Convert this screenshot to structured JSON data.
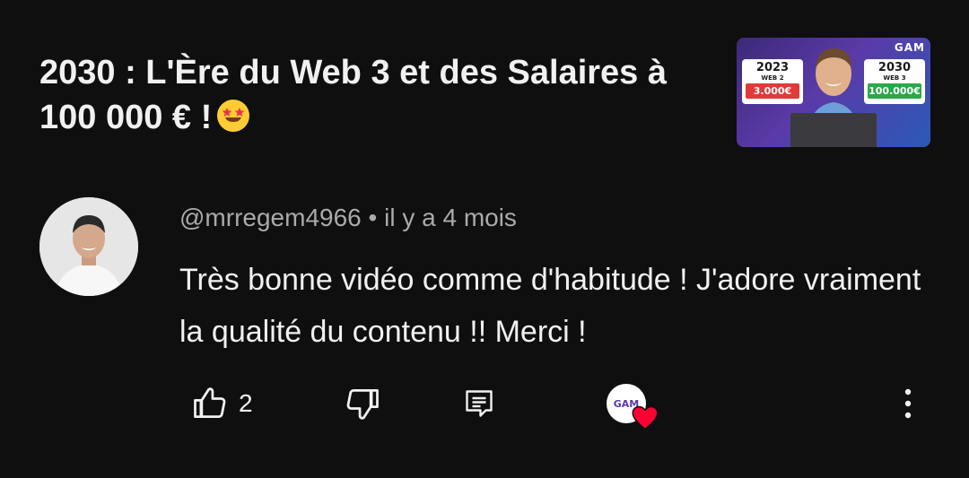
{
  "video": {
    "title": "2030 : L'Ère du Web 3 et des Salaires à 100 000 € !",
    "title_emoji": "star-struck-emoji",
    "thumbnail": {
      "logo": "GAM",
      "left_card": {
        "year": "2023",
        "web": "WEB 2",
        "amount": "3.000€"
      },
      "right_card": {
        "year": "2030",
        "web": "WEB 3",
        "amount": "100.000€"
      }
    }
  },
  "comment": {
    "author": "@mrregem4966",
    "separator": " • ",
    "time": "il y a 4 mois",
    "text": "Très bonne vidéo comme d'habitude ! J'adore vraiment la qualité du contenu !! Merci !",
    "like_count": "2",
    "creator_logo": "GAM"
  },
  "icons": {
    "like": "thumb-up-icon",
    "dislike": "thumb-down-icon",
    "reply": "comment-icon",
    "heart": "heart-icon",
    "more": "more-vertical-icon"
  },
  "colors": {
    "background": "#0f0f0f",
    "text_primary": "#f1f1f1",
    "text_secondary": "#aaaaaa",
    "heart": "#ff0033"
  }
}
